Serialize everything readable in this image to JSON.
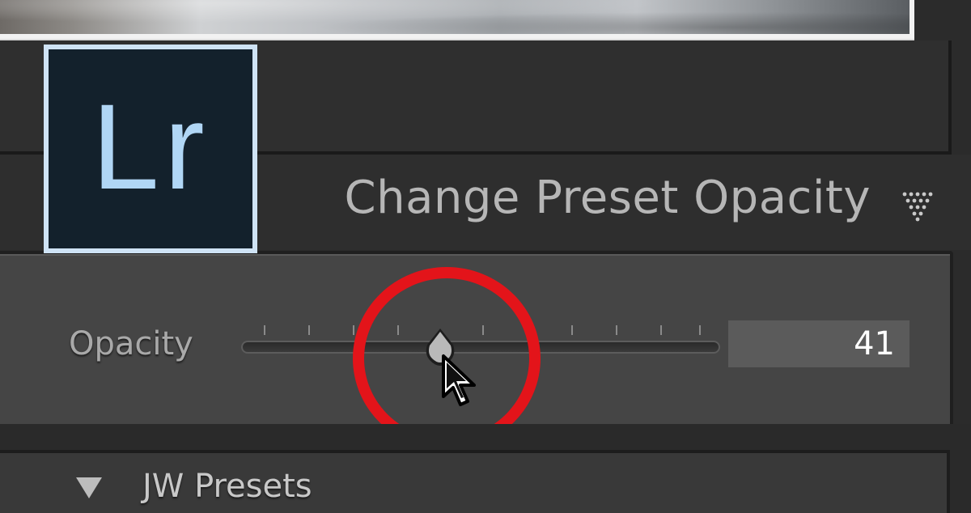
{
  "logo": {
    "text": "Lr",
    "border_color": "#cfe3f5",
    "background": "#13212c",
    "text_color": "#b0d6f5"
  },
  "panel": {
    "title": "Change Preset Opacity",
    "collapse_icon": "dotted-triangle-icon"
  },
  "opacity_slider": {
    "label": "Opacity",
    "value": "41",
    "level_fraction": 0.41,
    "highlight_color": "#e3141a"
  },
  "presets_section": {
    "label": "JW Presets",
    "toggle_icon": "disclosure-triangle-icon"
  },
  "cursor": {
    "icon": "mouse-pointer-icon"
  }
}
